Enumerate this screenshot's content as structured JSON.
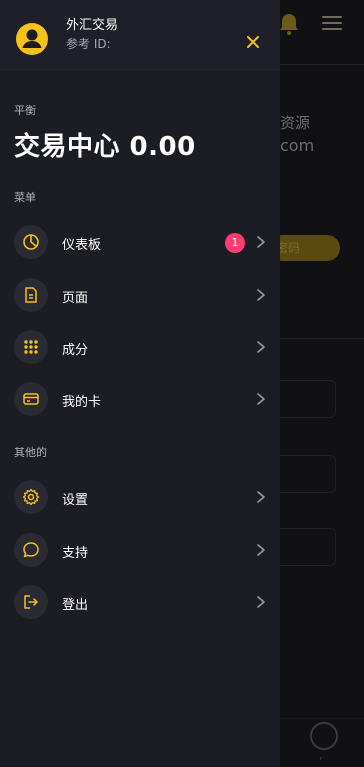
{
  "background": {
    "text_line1": "资源",
    "text_line2": "com",
    "pill_text": "密码"
  },
  "drawer": {
    "app_name": "外汇交易",
    "user_id_label": "参考 ID:",
    "balance_section_label": "平衡",
    "balance_value": "交易中心 0.00",
    "menu_section_label": "菜单",
    "menu_items": [
      {
        "label": "仪表板",
        "icon": "dashboard-icon",
        "badge": "1"
      },
      {
        "label": "页面",
        "icon": "document-icon"
      },
      {
        "label": "成分",
        "icon": "grid-dots-icon"
      },
      {
        "label": "我的卡",
        "icon": "card-icon"
      }
    ],
    "other_section_label": "其他的",
    "other_items": [
      {
        "label": "设置",
        "icon": "gear-icon"
      },
      {
        "label": "支持",
        "icon": "chat-icon"
      },
      {
        "label": "登出",
        "icon": "logout-icon"
      }
    ]
  },
  "colors": {
    "accent": "#f5c21b",
    "badge": "#ff3d6e",
    "drawer_bg": "#1c1c24",
    "icon_circle": "#2a2a33"
  }
}
